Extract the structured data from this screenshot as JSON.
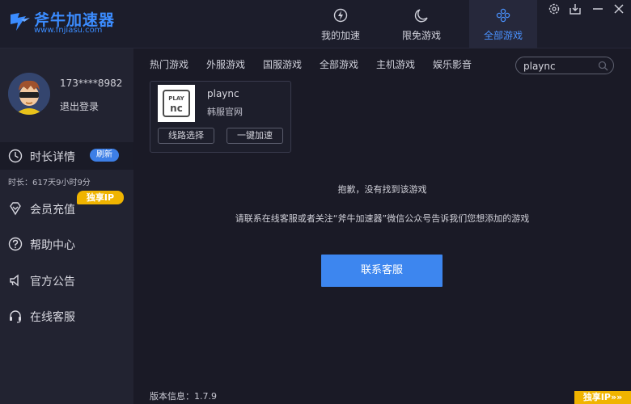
{
  "app": {
    "title": "斧牛加速器",
    "url": "www.fnjiasu.com"
  },
  "nav": {
    "tabs": [
      {
        "label": "我的加速",
        "icon": "power-icon"
      },
      {
        "label": "限免游戏",
        "icon": "moon-icon"
      },
      {
        "label": "全部游戏",
        "icon": "cluster-icon",
        "active": true
      }
    ]
  },
  "window": {
    "buttons": [
      "settings-icon",
      "download-icon",
      "minimize-icon",
      "close-icon"
    ]
  },
  "user": {
    "phone": "173****8982",
    "logout_label": "退出登录"
  },
  "sidebar": {
    "items": [
      {
        "label": "时长详情",
        "icon": "clock-icon",
        "active": true
      },
      {
        "label": "会员充值",
        "icon": "diamond-icon"
      },
      {
        "label": "帮助中心",
        "icon": "help-icon"
      },
      {
        "label": "官方公告",
        "icon": "megaphone-icon"
      },
      {
        "label": "在线客服",
        "icon": "headset-icon"
      }
    ],
    "refresh_badge": "刷新",
    "duration": "时长：617天9小时9分",
    "vip_badge": "独享IP"
  },
  "categories": [
    "热门游戏",
    "外服游戏",
    "国服游戏",
    "全部游戏",
    "主机游戏",
    "娱乐影音"
  ],
  "search": {
    "value": "plaync",
    "placeholder": ""
  },
  "game": {
    "name": "plaync",
    "region": "韩服官网",
    "logo_text": "PLAY NC",
    "buttons": [
      "线路选择",
      "一键加速"
    ]
  },
  "messages": {
    "not_found": "抱歉，没有找到该游戏",
    "contact_tip": "请联系在线客服或者关注“斧牛加速器”微信公众号告诉我们您想添加的游戏"
  },
  "contact_button": "联系客服",
  "version": "版本信息：1.7.9",
  "corner_ad": "独享IP»»",
  "colors": {
    "accent": "#3d86ef",
    "brand": "#3b8cff",
    "vip": "#f0b400",
    "background": "#1a1a26",
    "sidebar": "#222331"
  }
}
